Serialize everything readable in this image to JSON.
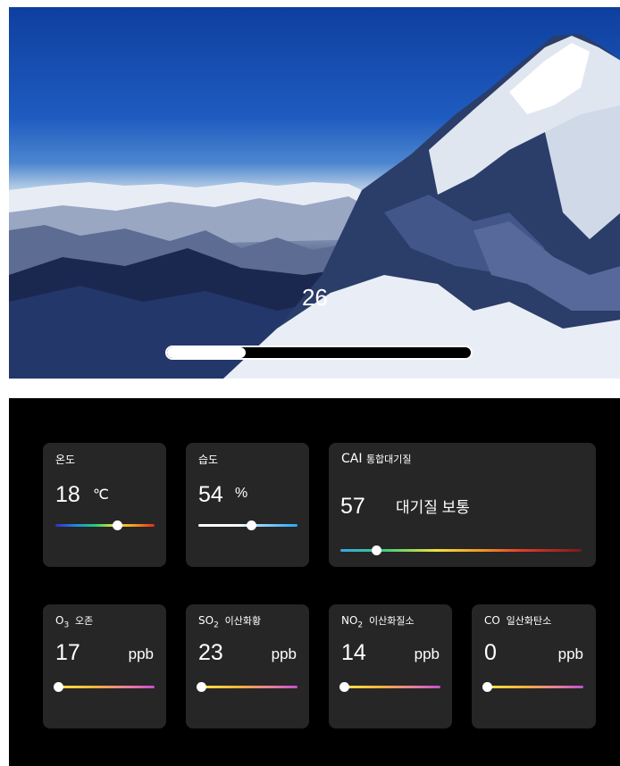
{
  "hero": {
    "counter": "26",
    "progress_fraction": 0.26,
    "image_icon": "mountain-photo"
  },
  "sensors": {
    "temperature": {
      "label": "온도",
      "value": "18",
      "unit": "℃",
      "level": 0.63
    },
    "humidity": {
      "label": "습도",
      "value": "54",
      "unit": "%",
      "level": 0.54
    },
    "cai": {
      "label_main": "CAI",
      "label_sub": "통합대기질",
      "value": "57",
      "status": "대기질 보통",
      "level": 0.15
    },
    "o3": {
      "label_main": "O",
      "label_subscript": "3",
      "label_name": "오존",
      "value": "17",
      "unit": "ppb",
      "level": 0.0
    },
    "so2": {
      "label_main": "SO",
      "label_subscript": "2",
      "label_name": "이산화황",
      "value": "23",
      "unit": "ppb",
      "level": 0.0
    },
    "no2": {
      "label_main": "NO",
      "label_subscript": "2",
      "label_name": "이산화질소",
      "value": "14",
      "unit": "ppb",
      "level": 0.0
    },
    "co": {
      "label_main": "CO",
      "label_name": "일산화탄소",
      "value": "0",
      "unit": "ppb",
      "level": 0.0
    }
  },
  "colors": {
    "background": "#000000",
    "card": "#262626",
    "text": "#ffffff"
  }
}
